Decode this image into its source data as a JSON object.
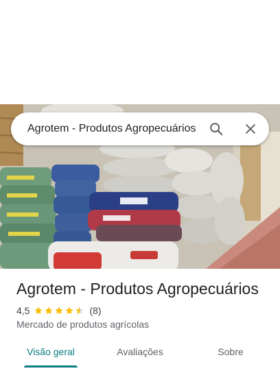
{
  "search": {
    "query": "Agrotem - Produtos Agropecuários"
  },
  "place": {
    "title": "Agrotem - Produtos Agropecuários",
    "rating": "4,5",
    "rating_value": 4.5,
    "review_count": "(8)",
    "category": "Mercado de produtos agrícolas"
  },
  "tabs": [
    {
      "label": "Visão geral",
      "active": true
    },
    {
      "label": "Avaliações",
      "active": false
    },
    {
      "label": "Sobre",
      "active": false
    }
  ],
  "colors": {
    "accent": "#0b7c82",
    "star": "#fbbc04"
  },
  "icons": {
    "search": "search-icon",
    "close": "close-icon",
    "star": "star-icon"
  }
}
